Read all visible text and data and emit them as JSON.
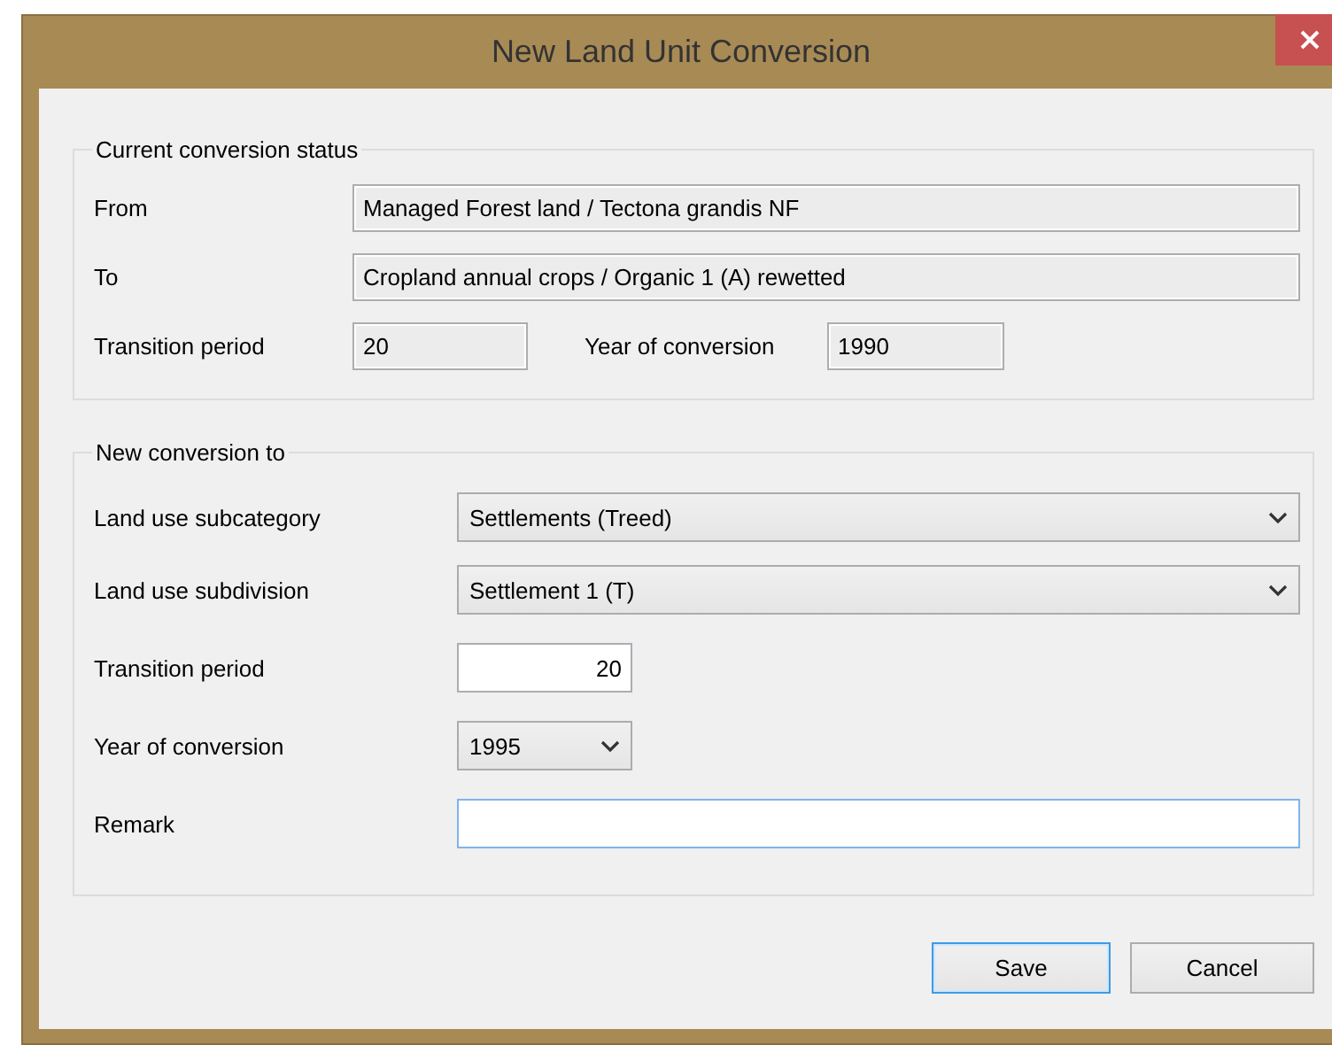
{
  "window": {
    "title": "New Land Unit Conversion"
  },
  "current_status": {
    "legend": "Current conversion status",
    "from": {
      "label": "From",
      "value": "Managed Forest land / Tectona grandis NF"
    },
    "to": {
      "label": "To",
      "value": "Cropland annual crops / Organic 1 (A) rewetted"
    },
    "transition_period": {
      "label": "Transition period",
      "value": "20"
    },
    "year_of_conversion": {
      "label": "Year of conversion",
      "value": "1990"
    }
  },
  "new_conversion": {
    "legend": "New conversion to",
    "fields": [
      {
        "label": "Land use subcategory",
        "kind": "dropdown",
        "value": "Settlements (Treed)",
        "focused": false
      },
      {
        "label": "Land use subdivision",
        "kind": "dropdown",
        "value": "Settlement 1 (T)",
        "focused": false
      },
      {
        "label": "Transition period",
        "kind": "number",
        "value": "20",
        "focused": false
      },
      {
        "label": "Year of conversion",
        "kind": "short_dropdown",
        "value": "1995",
        "focused": false
      },
      {
        "label": "Remark",
        "kind": "text",
        "focused": true
      }
    ]
  },
  "buttons": [
    {
      "label": "Save",
      "default": true
    },
    {
      "label": "Cancel",
      "default": false
    }
  ]
}
